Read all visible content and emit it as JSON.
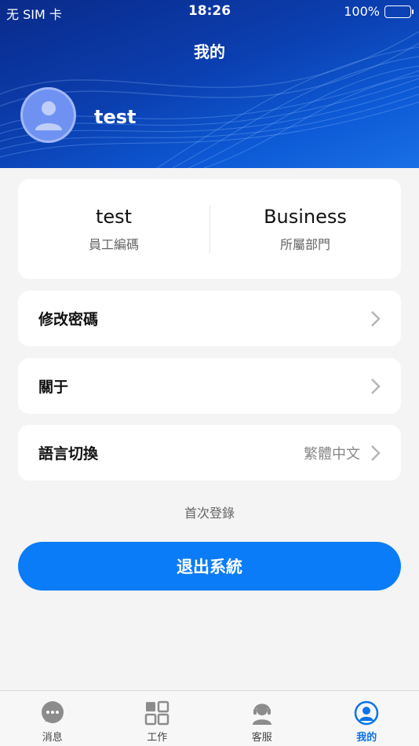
{
  "status_bar": {
    "carrier": "无 SIM 卡",
    "time": "18:26",
    "battery": "100%"
  },
  "header": {
    "title": "我的",
    "username": "test"
  },
  "info": [
    {
      "value": "test",
      "label": "員工編碼"
    },
    {
      "value": "Business",
      "label": "所屬部門"
    }
  ],
  "menu": {
    "change_password": "修改密碼",
    "about": "關于",
    "language_label": "語言切換",
    "language_value": "繁體中文"
  },
  "first_login": "首次登錄",
  "logout_label": "退出系統",
  "tabs": [
    {
      "label": "消息",
      "icon": "chat-icon"
    },
    {
      "label": "工作",
      "icon": "grid-icon"
    },
    {
      "label": "客服",
      "icon": "support-icon"
    },
    {
      "label": "我的",
      "icon": "profile-icon"
    }
  ],
  "colors": {
    "accent": "#0a7cf7",
    "header_dark": "#0a2a8a",
    "active_tab": "#0a74e8"
  }
}
